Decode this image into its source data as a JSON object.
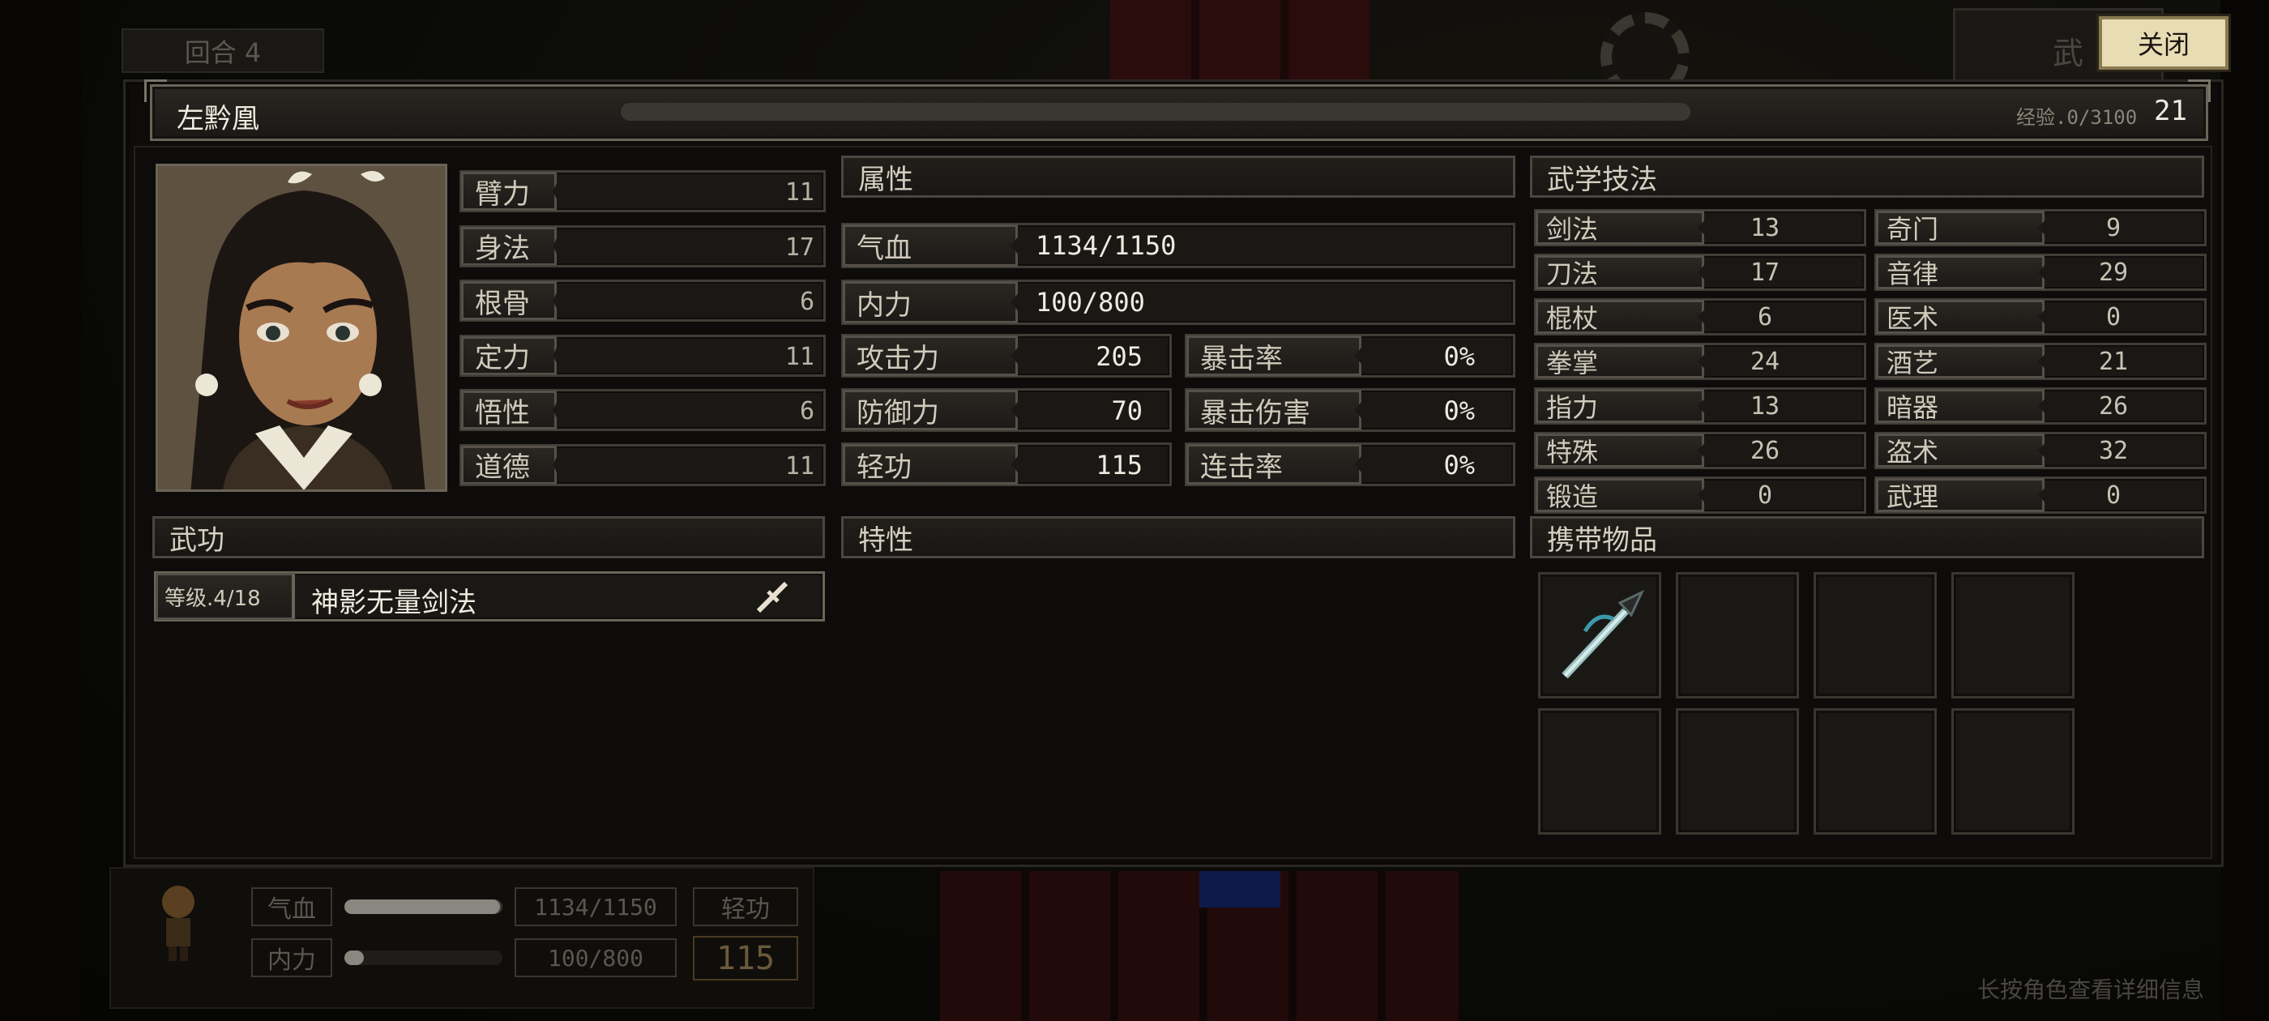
{
  "background": {
    "turn_label": "回合 4",
    "top_right_button": "武",
    "hud": {
      "hp_label": "气血",
      "hp_value": "1134/1150",
      "hp_fraction": 0.986,
      "mp_label": "内力",
      "mp_value": "100/800",
      "mp_fraction": 0.125,
      "qinggong_label": "轻功",
      "qinggong_value": "115"
    },
    "hint": "长按角色查看详细信息"
  },
  "close_button": "关闭",
  "header": {
    "name": "左黔凰",
    "exp_label": "经验.0/3100",
    "exp_fraction": 0.0,
    "level": "21"
  },
  "base_stats": [
    {
      "label": "臂力",
      "value": "11"
    },
    {
      "label": "身法",
      "value": "17"
    },
    {
      "label": "根骨",
      "value": "6"
    },
    {
      "label": "定力",
      "value": "11"
    },
    {
      "label": "悟性",
      "value": "6"
    },
    {
      "label": "道德",
      "value": "11"
    }
  ],
  "attributes": {
    "title": "属性",
    "hp": {
      "label": "气血",
      "value": "1134/1150"
    },
    "mp": {
      "label": "内力",
      "value": "100/800"
    },
    "rows": [
      {
        "label": "攻击力",
        "value": "205",
        "label2": "暴击率",
        "value2": "0%"
      },
      {
        "label": "防御力",
        "value": "70",
        "label2": "暴击伤害",
        "value2": "0%"
      },
      {
        "label": "轻功",
        "value": "115",
        "label2": "连击率",
        "value2": "0%"
      }
    ]
  },
  "martial_skills": {
    "title": "武学技法",
    "left": [
      {
        "label": "剑法",
        "value": "13"
      },
      {
        "label": "刀法",
        "value": "17"
      },
      {
        "label": "棍杖",
        "value": "6"
      },
      {
        "label": "拳掌",
        "value": "24"
      },
      {
        "label": "指力",
        "value": "13"
      },
      {
        "label": "特殊",
        "value": "26"
      },
      {
        "label": "锻造",
        "value": "0"
      }
    ],
    "right": [
      {
        "label": "奇门",
        "value": "9"
      },
      {
        "label": "音律",
        "value": "29"
      },
      {
        "label": "医术",
        "value": "0"
      },
      {
        "label": "酒艺",
        "value": "21"
      },
      {
        "label": "暗器",
        "value": "26"
      },
      {
        "label": "盗术",
        "value": "32"
      },
      {
        "label": "武理",
        "value": "0"
      }
    ]
  },
  "wugong": {
    "title": "武功",
    "items": [
      {
        "level": "等级.4/18",
        "name": "神影无量剑法",
        "icon": "sword-icon"
      }
    ]
  },
  "traits": {
    "title": "特性"
  },
  "inventory": {
    "title": "携带物品",
    "slots": [
      "spear-icon",
      "",
      "",
      "",
      "",
      "",
      "",
      ""
    ]
  },
  "colors": {
    "panel_bg": "#0d0c0a",
    "label_border": "#55504a",
    "text_main": "#d6d0c2",
    "close_button_bg": "#e8dcb4"
  }
}
